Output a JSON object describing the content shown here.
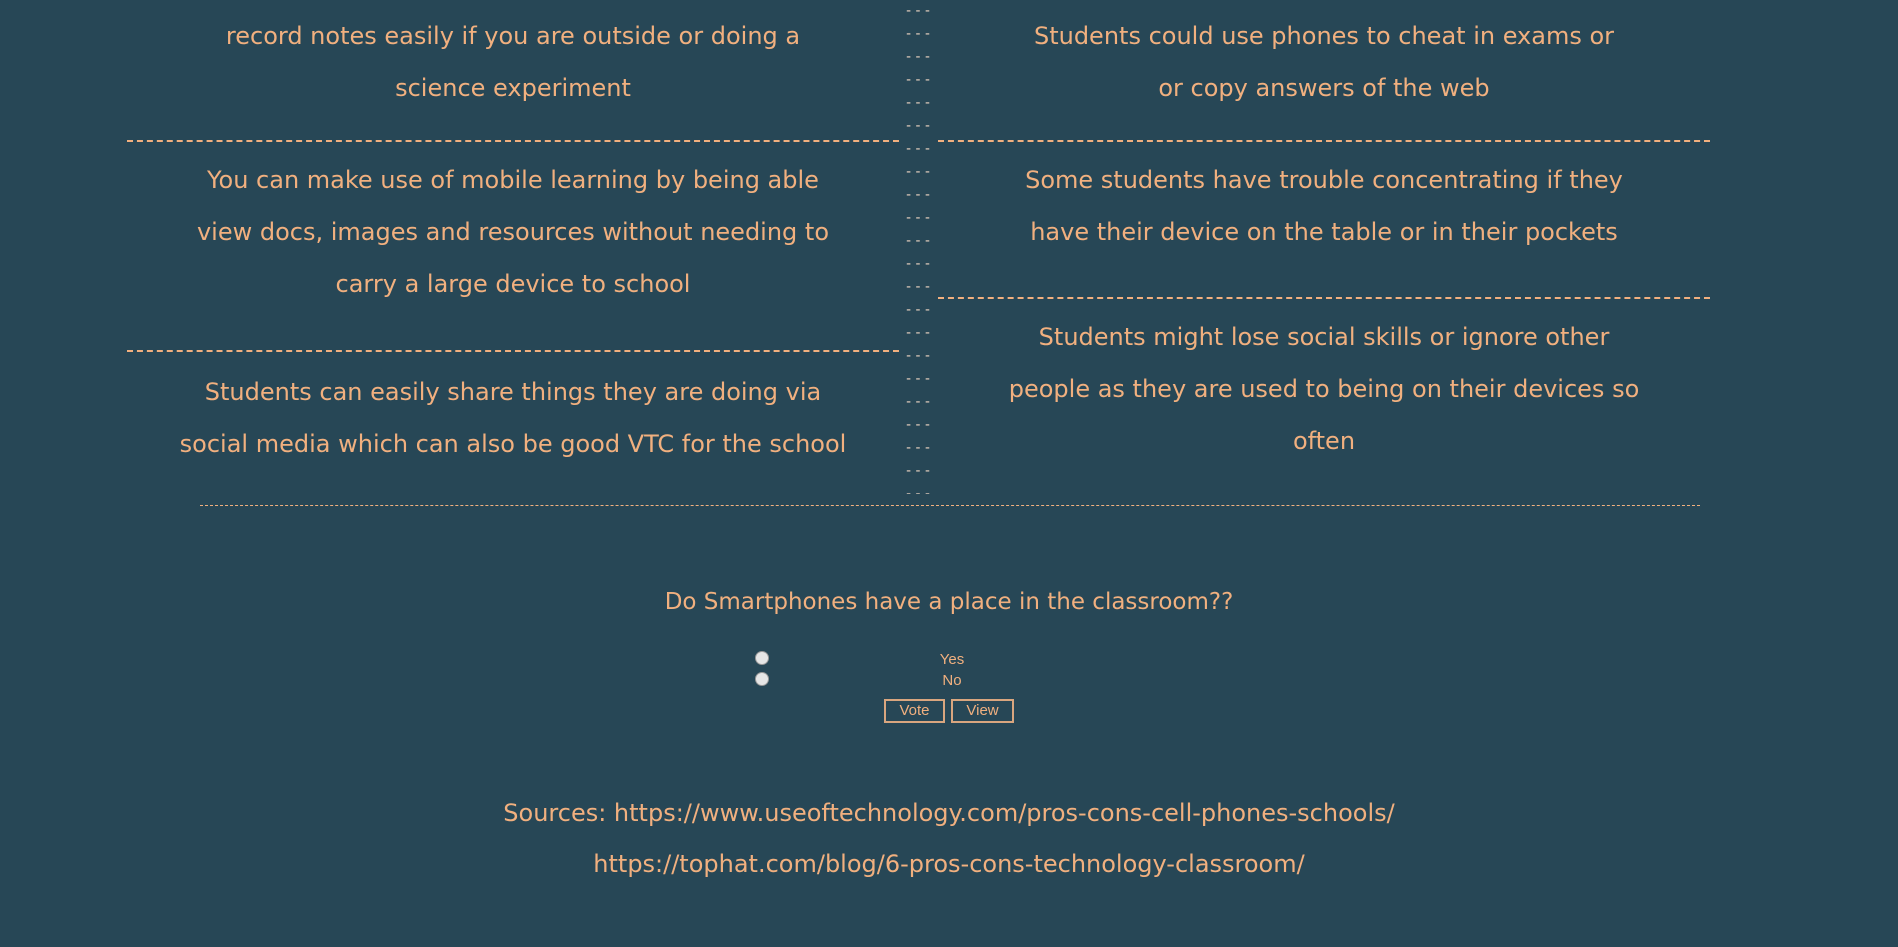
{
  "pros": [
    {
      "lines": [
        "record notes easily if you are outside or doing a",
        "science experiment"
      ]
    },
    {
      "lines": [
        "You can make use of mobile learning by being able",
        "view docs, images and resources without needing to",
        "carry a large device to school"
      ]
    },
    {
      "lines": [
        "Students can easily share things they are doing via",
        "social media which can also be good VTC for the school"
      ]
    }
  ],
  "cons": [
    {
      "lines": [
        "Students could use phones to cheat in exams or",
        "or copy answers of the web"
      ]
    },
    {
      "lines": [
        "Some students have trouble concentrating if they",
        "have their device on the table or in their pockets"
      ]
    },
    {
      "lines": [
        "Students might lose social skills or ignore other",
        "people as they are used to being on their devices so",
        "often"
      ]
    }
  ],
  "divider": {
    "column_glyph": "---"
  },
  "poll": {
    "question": "Do Smartphones have a place in the classroom??",
    "options": [
      "Yes",
      "No"
    ],
    "vote_label": "Vote",
    "view_label": "View"
  },
  "sources": {
    "line1": "Sources: https://www.useoftechnology.com/pros-cons-cell-phones-schools/",
    "line2": "https://tophat.com/blog/6-pros-cons-technology-classroom/"
  },
  "colors": {
    "background": "#274756",
    "text": "#f1b07f",
    "divider_glyph": "#e8d2c0",
    "radio": "#e6e6e6"
  }
}
